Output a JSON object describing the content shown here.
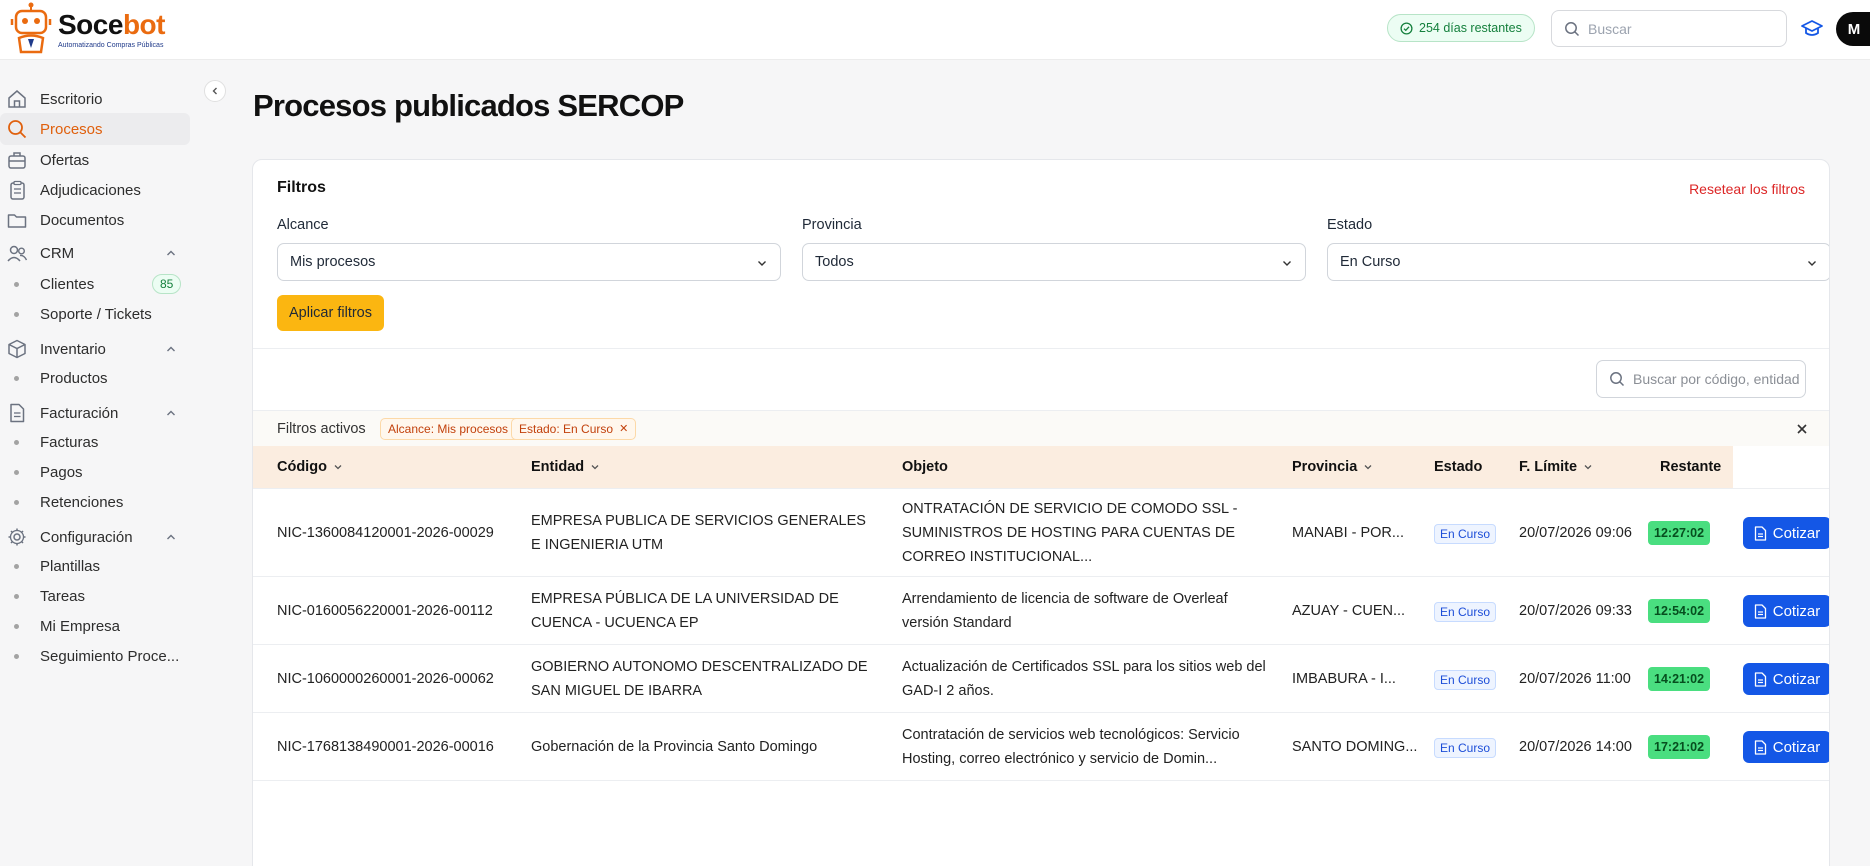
{
  "header": {
    "brand_name_a": "Soce",
    "brand_name_b": "bot",
    "brand_tagline": "Automatizando Compras Públicas",
    "days_remaining": "254 días restantes",
    "search_placeholder": "Buscar",
    "avatar_initial": "M"
  },
  "sidebar": {
    "items": [
      {
        "label": "Escritorio",
        "icon": "home-icon"
      },
      {
        "label": "Procesos",
        "icon": "search-icon",
        "active": true
      },
      {
        "label": "Ofertas",
        "icon": "briefcase-icon"
      },
      {
        "label": "Adjudicaciones",
        "icon": "clipboard-icon"
      },
      {
        "label": "Documentos",
        "icon": "folder-icon"
      }
    ],
    "crm": {
      "label": "CRM",
      "children": [
        {
          "label": "Clientes",
          "badge": "85"
        },
        {
          "label": "Soporte / Tickets"
        }
      ]
    },
    "inventario": {
      "label": "Inventario",
      "children": [
        {
          "label": "Productos"
        }
      ]
    },
    "facturacion": {
      "label": "Facturación",
      "children": [
        {
          "label": "Facturas"
        },
        {
          "label": "Pagos"
        },
        {
          "label": "Retenciones"
        }
      ]
    },
    "configuracion": {
      "label": "Configuración",
      "children": [
        {
          "label": "Plantillas"
        },
        {
          "label": "Tareas"
        },
        {
          "label": "Mi Empresa"
        },
        {
          "label": "Seguimiento Proce..."
        }
      ]
    }
  },
  "main": {
    "title": "Procesos publicados SERCOP",
    "filters": {
      "title": "Filtros",
      "reset_label": "Resetear los filtros",
      "alcance_label": "Alcance",
      "alcance_value": "Mis procesos",
      "provincia_label": "Provincia",
      "provincia_value": "Todos",
      "estado_label": "Estado",
      "estado_value": "En Curso",
      "apply_label": "Aplicar filtros"
    },
    "table_search_placeholder": "Buscar por código, entidad",
    "active_filters": {
      "label": "Filtros activos",
      "chips": [
        "Alcance: Mis procesos",
        "Estado: En Curso"
      ]
    },
    "table": {
      "headers": {
        "codigo": "Código",
        "entidad": "Entidad",
        "objeto": "Objeto",
        "provincia": "Provincia",
        "estado": "Estado",
        "limite": "F. Límite",
        "restante": "Restante"
      },
      "action_label": "Cotizar",
      "rows": [
        {
          "codigo": "NIC-1360084120001-2026-00029",
          "entidad": "EMPRESA PUBLICA DE SERVICIOS GENERALES E INGENIERIA UTM",
          "objeto": "ONTRATACIÓN DE SERVICIO DE COMODO SSL - SUMINISTROS DE HOSTING PARA CUENTAS DE CORREO INSTITUCIONAL...",
          "provincia": "MANABI - POR...",
          "estado": "En Curso",
          "limite": "20/07/2026 09:06",
          "restante": "12:27:02"
        },
        {
          "codigo": "NIC-0160056220001-2026-00112",
          "entidad": "EMPRESA PÚBLICA DE LA UNIVERSIDAD DE CUENCA - UCUENCA EP",
          "objeto": "Arrendamiento de licencia de software de Overleaf versión Standard",
          "provincia": "AZUAY - CUEN...",
          "estado": "En Curso",
          "limite": "20/07/2026 09:33",
          "restante": "12:54:02"
        },
        {
          "codigo": "NIC-1060000260001-2026-00062",
          "entidad": "GOBIERNO AUTONOMO DESCENTRALIZADO DE SAN MIGUEL DE IBARRA",
          "objeto": "Actualización de Certificados SSL para los sitios web del GAD-I 2 años.",
          "provincia": "IMBABURA - I...",
          "estado": "En Curso",
          "limite": "20/07/2026 11:00",
          "restante": "14:21:02"
        },
        {
          "codigo": "NIC-1768138490001-2026-00016",
          "entidad": "Gobernación de la Provincia Santo Domingo",
          "objeto": "Contratación de servicios web tecnológicos: Servicio Hosting, correo electrónico y servicio de Domin...",
          "provincia": "SANTO DOMING...",
          "estado": "En Curso",
          "limite": "20/07/2026 14:00",
          "restante": "17:21:02"
        }
      ]
    }
  }
}
